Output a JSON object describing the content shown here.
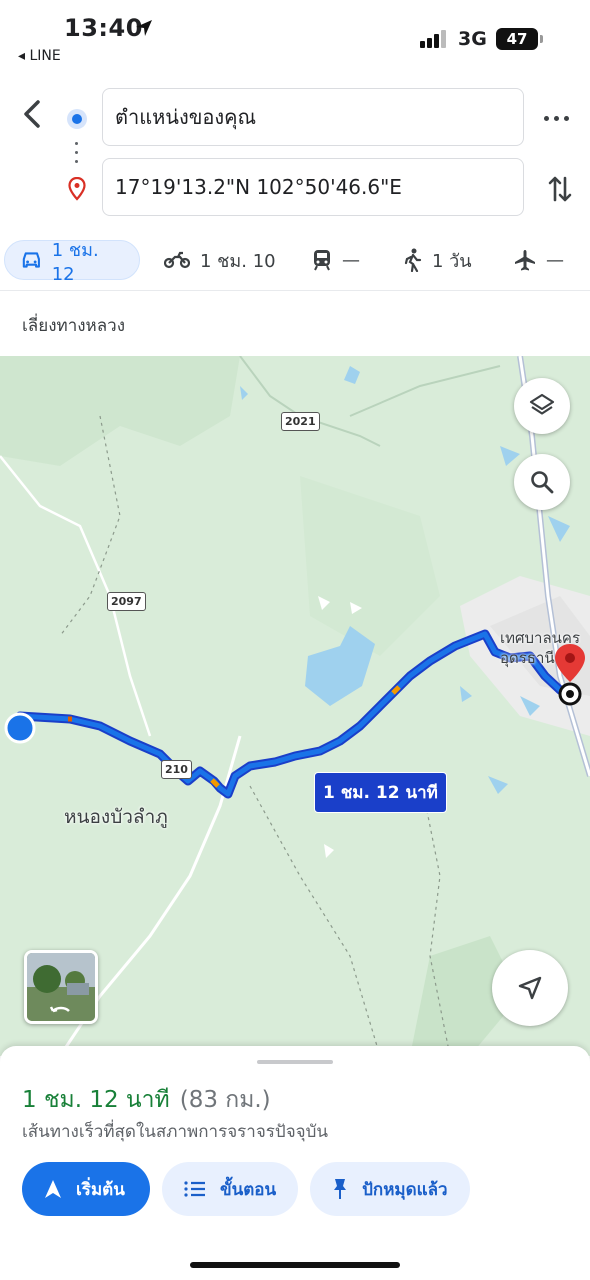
{
  "status_bar": {
    "time": "13:40",
    "back_app": "◂ LINE",
    "network": "3G",
    "battery": "47"
  },
  "directions": {
    "origin": "ตำแหน่งของคุณ",
    "destination": "17°19'13.2\"N 102°50'46.6\"E",
    "modes": [
      {
        "icon": "car-icon",
        "label": "1 ชม. 12"
      },
      {
        "icon": "motorcycle-icon",
        "label": "1 ชม. 10"
      },
      {
        "icon": "transit-icon",
        "label": "—"
      },
      {
        "icon": "walk-icon",
        "label": "1 วัน"
      },
      {
        "icon": "flight-icon",
        "label": "—"
      }
    ],
    "option": "เลี่ยงทางหลวง"
  },
  "map": {
    "route_label": "1 ชม. 12 นาที",
    "place_label": "หนองบัวลำภู",
    "city_label_1": "เทศบาลนคร",
    "city_label_2": "อุดรธานี",
    "road_shields": [
      "2021",
      "2097",
      "210"
    ]
  },
  "sheet": {
    "duration": "1 ชม. 12 นาที",
    "distance": "(83 กม.)",
    "description": "เส้นทางเร็วที่สุดในสภาพการจราจรปัจจุบัน",
    "start_label": "เริ่มต้น",
    "steps_label": "ขั้นตอน",
    "pinned_label": "ปักหมุดแล้ว"
  },
  "colors": {
    "route": "#1a3fc9",
    "accent": "#1a73e8",
    "duration_green": "#188038",
    "map_bg": "#d9ecd9",
    "destination_pin": "#e53935"
  }
}
